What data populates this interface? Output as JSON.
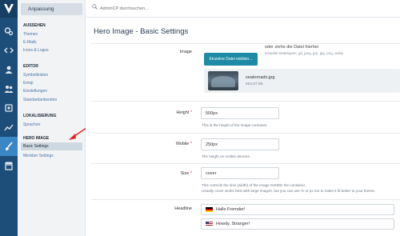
{
  "app": {
    "search_placeholder": "AdminCP durchsuchen..."
  },
  "sidebar": {
    "title": "Anpassung",
    "sections": [
      {
        "label": "AUSSEHEN",
        "items": [
          "Themes",
          "E-Mails",
          "Icons & Logos"
        ]
      },
      {
        "label": "EDITOR",
        "items": [
          "Symbolleisten",
          "Emoji",
          "Einstellungen",
          "Standardantworten"
        ]
      },
      {
        "label": "LOKALISIERUNG",
        "items": [
          "Sprachen"
        ]
      },
      {
        "label": "HERO IMAGE",
        "items": [
          "Basic Settings",
          "Member Settings"
        ]
      }
    ],
    "active_item": "Basic Settings"
  },
  "page": {
    "title": "Hero Image - Basic Settings",
    "image": {
      "label": "Image",
      "upload_button": "Einzelne Datei wählen...",
      "or_drop": "oder ziehe die Datei hierher",
      "allowed": "Erlaubte Dateitypen: gif, jpeg, jpe, jpg, png, webp",
      "file_name": "seatornado.jpg",
      "file_size": "653,87 kB"
    },
    "height": {
      "label": "Height",
      "value": "500px",
      "hint": "This is the height of the image container."
    },
    "mobile": {
      "label": "Mobile",
      "value": "250px",
      "hint": "The height on mobile devices."
    },
    "size": {
      "label": "Size",
      "value": "cover",
      "hint1": "This controls the size (width) of the image INSIDE the container.",
      "hint2": "Usually cover works best with large images, but you can use % or px too to make it fit better to your theme."
    },
    "headline": {
      "label": "Headline",
      "phrases": [
        "Hallo Fremder!",
        "Howdy, Stranger!"
      ]
    },
    "required_marker": "*"
  },
  "colors": {
    "rail": "#1d4e79",
    "rail_active": "#3b86c4",
    "upload_button": "#1d8aa6",
    "link": "#4a76a8",
    "annotation_arrow": "#e02020"
  },
  "rail_icons": [
    "logo-icon",
    "gears-icon",
    "code-icon",
    "user-icon",
    "users-icon",
    "group-icon",
    "chart-icon",
    "paintbrush-icon",
    "shop-icon"
  ]
}
